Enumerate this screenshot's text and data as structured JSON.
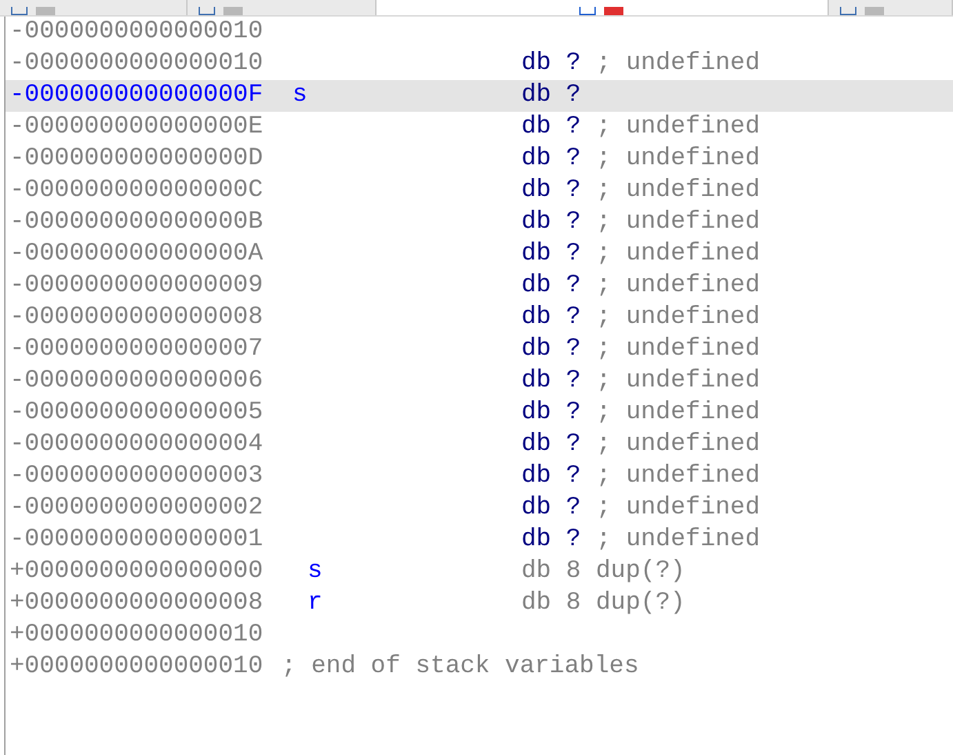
{
  "tabs": [
    {
      "selected": false
    },
    {
      "selected": false
    },
    {
      "selected": true
    },
    {
      "selected": false
    }
  ],
  "rows": [
    {
      "address": "-0000000000000010",
      "selected": false,
      "kind": "boundary"
    },
    {
      "address": "-0000000000000010",
      "definition": "db ?",
      "comment": "; undefined",
      "selected": false,
      "kind": "undefined"
    },
    {
      "address": "-000000000000000F",
      "name": "s",
      "definition": "db ?",
      "selected": true,
      "kind": "field"
    },
    {
      "address": "-000000000000000E",
      "definition": "db ?",
      "comment": "; undefined",
      "selected": false,
      "kind": "undefined"
    },
    {
      "address": "-000000000000000D",
      "definition": "db ?",
      "comment": "; undefined",
      "selected": false,
      "kind": "undefined"
    },
    {
      "address": "-000000000000000C",
      "definition": "db ?",
      "comment": "; undefined",
      "selected": false,
      "kind": "undefined"
    },
    {
      "address": "-000000000000000B",
      "definition": "db ?",
      "comment": "; undefined",
      "selected": false,
      "kind": "undefined"
    },
    {
      "address": "-000000000000000A",
      "definition": "db ?",
      "comment": "; undefined",
      "selected": false,
      "kind": "undefined"
    },
    {
      "address": "-0000000000000009",
      "definition": "db ?",
      "comment": "; undefined",
      "selected": false,
      "kind": "undefined"
    },
    {
      "address": "-0000000000000008",
      "definition": "db ?",
      "comment": "; undefined",
      "selected": false,
      "kind": "undefined"
    },
    {
      "address": "-0000000000000007",
      "definition": "db ?",
      "comment": "; undefined",
      "selected": false,
      "kind": "undefined"
    },
    {
      "address": "-0000000000000006",
      "definition": "db ?",
      "comment": "; undefined",
      "selected": false,
      "kind": "undefined"
    },
    {
      "address": "-0000000000000005",
      "definition": "db ?",
      "comment": "; undefined",
      "selected": false,
      "kind": "undefined"
    },
    {
      "address": "-0000000000000004",
      "definition": "db ?",
      "comment": "; undefined",
      "selected": false,
      "kind": "undefined"
    },
    {
      "address": "-0000000000000003",
      "definition": "db ?",
      "comment": "; undefined",
      "selected": false,
      "kind": "undefined"
    },
    {
      "address": "-0000000000000002",
      "definition": "db ?",
      "comment": "; undefined",
      "selected": false,
      "kind": "undefined"
    },
    {
      "address": "-0000000000000001",
      "definition": "db ?",
      "comment": "; undefined",
      "selected": false,
      "kind": "undefined"
    },
    {
      "address": "+0000000000000000",
      "name": "s",
      "definition": "db 8 dup(?)",
      "selected": false,
      "kind": "member"
    },
    {
      "address": "+0000000000000008",
      "name": "r",
      "definition": "db 8 dup(?)",
      "selected": false,
      "kind": "member"
    },
    {
      "address": "+0000000000000010",
      "selected": false,
      "kind": "boundary"
    },
    {
      "address": "+0000000000000010",
      "comment": "; end of stack variables",
      "selected": false,
      "kind": "end"
    }
  ]
}
